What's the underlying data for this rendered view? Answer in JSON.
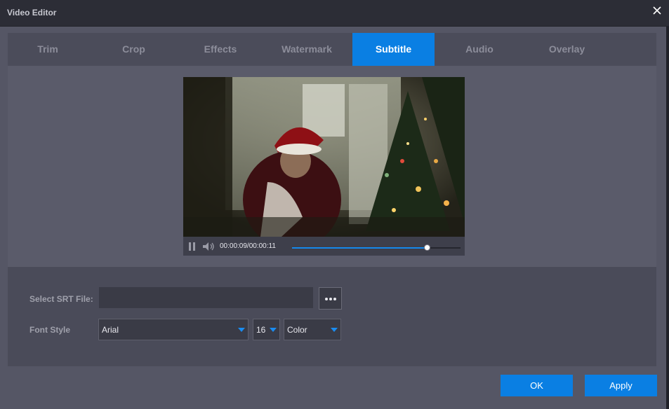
{
  "window": {
    "title": "Video Editor"
  },
  "tabs": [
    {
      "label": "Trim"
    },
    {
      "label": "Crop"
    },
    {
      "label": "Effects"
    },
    {
      "label": "Watermark"
    },
    {
      "label": "Subtitle",
      "active": true
    },
    {
      "label": "Audio"
    },
    {
      "label": "Overlay"
    }
  ],
  "player": {
    "time_display": "00:00:09/00:00:11",
    "progress": 0.8
  },
  "subtitle": {
    "srt_label": "Select SRT File:",
    "srt_value": "",
    "font_style_label": "Font Style",
    "font_name": "Arial",
    "font_size": "16",
    "color_label": "Color"
  },
  "footer": {
    "ok_label": "OK",
    "apply_label": "Apply"
  },
  "colors": {
    "accent": "#0a7fe3",
    "background": "#4a4b59",
    "titlebar": "#2c2d36"
  }
}
